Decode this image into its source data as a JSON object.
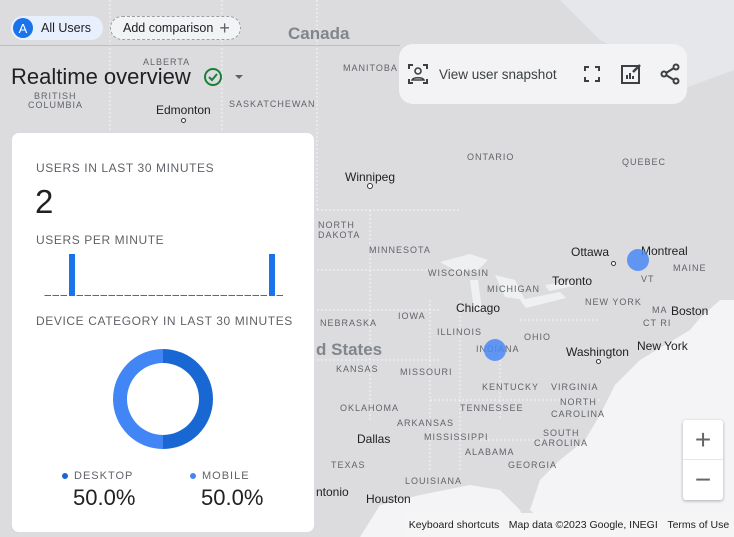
{
  "segments": {
    "all_users": "All Users",
    "avatar_letter": "A",
    "add_comparison": "Add comparison"
  },
  "page": {
    "title": "Realtime overview"
  },
  "toolbar": {
    "view_snapshot": "View user snapshot"
  },
  "card": {
    "users_label": "USERS IN LAST 30 MINUTES",
    "users_value": "2",
    "per_minute_label": "USERS PER MINUTE",
    "device_label": "DEVICE CATEGORY IN LAST 30 MINUTES",
    "legend": [
      {
        "name": "DESKTOP",
        "value": "50.0%",
        "color": "#1967d2"
      },
      {
        "name": "MOBILE",
        "value": "50.0%",
        "color": "#4285f4"
      }
    ]
  },
  "chart_data": [
    {
      "type": "bar",
      "title": "USERS PER MINUTE",
      "values": [
        0,
        0,
        0,
        1,
        0,
        0,
        0,
        0,
        0,
        0,
        0,
        0,
        0,
        0,
        0,
        0,
        0,
        0,
        0,
        0,
        0,
        0,
        0,
        0,
        0,
        0,
        0,
        0,
        1,
        0
      ],
      "color": "#1a73e8"
    },
    {
      "type": "pie",
      "title": "DEVICE CATEGORY IN LAST 30 MINUTES",
      "categories": [
        "DESKTOP",
        "MOBILE"
      ],
      "values": [
        50.0,
        50.0
      ],
      "colors": [
        "#1967d2",
        "#4285f4"
      ]
    }
  ],
  "map": {
    "countries": [
      "Canada",
      "d States"
    ],
    "regions": [
      "ALBERTA",
      "MANITOBA",
      "BRITISH",
      "COLUMBIA",
      "SASKATCHEWAN",
      "ONTARIO",
      "QUEBEC",
      "NORTH",
      "DAKOTA",
      "MINNESOTA",
      "WISCONSIN",
      "MICHIGAN",
      "MAINE",
      "VT",
      "NEW YORK",
      "MA",
      "CT RI",
      "IOWA",
      "NEBRASKA",
      "ILLINOIS",
      "INDIANA",
      "OHIO",
      "KANSAS",
      "MISSOURI",
      "KENTUCKY",
      "VIRGINIA",
      "TENNESSEE",
      "NORTH",
      "CAROLINA",
      "OKLAHOMA",
      "ARKANSAS",
      "SOUTH",
      "CAROLINA",
      "MISSISSIPPI",
      "ALABAMA",
      "GEORGIA",
      "TEXAS",
      "LOUISIANA"
    ],
    "cities": [
      "Edmonton",
      "Winnipeg",
      "Ottawa",
      "Montreal",
      "Toronto",
      "Chicago",
      "Boston",
      "New York",
      "Washington",
      "Dallas",
      "Houston",
      "ntonio"
    ],
    "footer": {
      "shortcuts": "Keyboard shortcuts",
      "data": "Map data ©2023 Google, INEGI",
      "terms": "Terms of Use"
    }
  }
}
